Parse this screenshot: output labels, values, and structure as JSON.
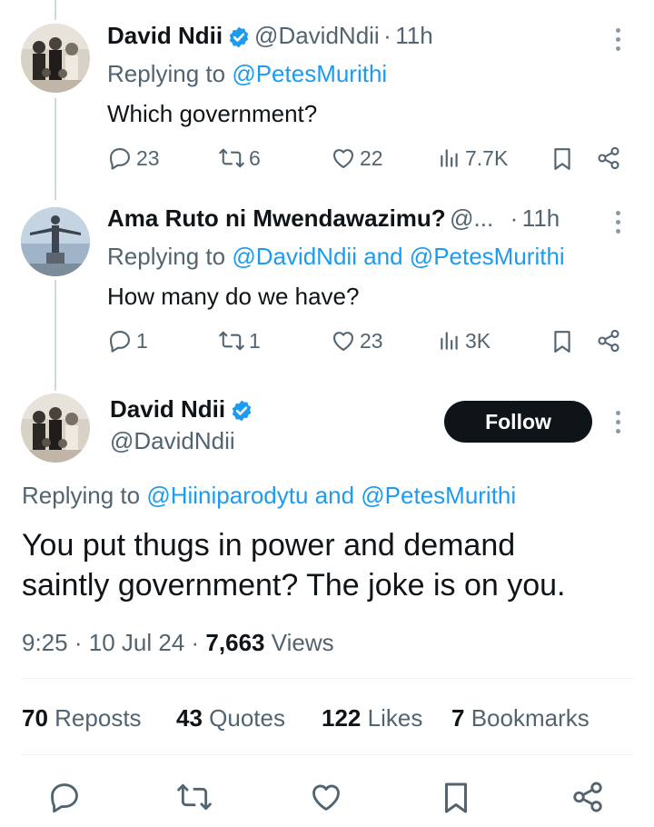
{
  "tweets": [
    {
      "name": "David Ndii",
      "handle": "@DavidNdii",
      "sep": "·",
      "time": "11h",
      "replying_prefix": "Replying to",
      "replying_to": "@PetesMurithi",
      "text": "Which government?",
      "replies": "23",
      "reposts": "6",
      "likes": "22",
      "views": "7.7K"
    },
    {
      "name": "Ama Ruto ni Mwendawazimu?",
      "handle": "@...",
      "sep": "·",
      "time": "11h",
      "replying_prefix": "Replying to",
      "replying_to": "@DavidNdii and @PetesMurithi",
      "text": "How many do we have?",
      "replies": "1",
      "reposts": "1",
      "likes": "23",
      "views": "3K"
    }
  ],
  "main_tweet": {
    "name": "David Ndii",
    "handle": "@DavidNdii",
    "follow_label": "Follow",
    "replying_prefix": "Replying to",
    "replying_to": "@Hiiniparodytu and @PetesMurithi",
    "text": "You put thugs in power and demand saintly government? The joke is on you.",
    "time": "9:25",
    "date": "10 Jul 24",
    "sep": "·",
    "views_count": "7,663",
    "views_label": "Views"
  },
  "stats": {
    "reposts_count": "70",
    "reposts_label": "Reposts",
    "quotes_count": "43",
    "quotes_label": "Quotes",
    "likes_count": "122",
    "likes_label": "Likes",
    "bookmarks_count": "7",
    "bookmarks_label": "Bookmarks"
  },
  "colors": {
    "link": "#1d9bf0",
    "muted": "#536471",
    "text": "#0f1419",
    "verified": "#1d9bf0"
  },
  "icons": [
    "reply-icon",
    "repost-icon",
    "like-icon",
    "views-icon",
    "bookmark-icon",
    "share-icon",
    "verified-icon",
    "more-icon"
  ]
}
